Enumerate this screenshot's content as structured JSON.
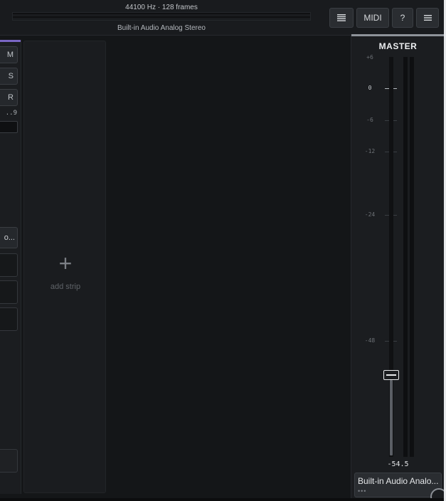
{
  "topbar": {
    "status": "44100 Hz · 128 frames",
    "device": "Built-in Audio Analog Stereo",
    "buttons": {
      "list_icon": "list-icon",
      "midi_label": "MIDI",
      "help_label": "?",
      "menu_icon": "hamburger-menu-icon"
    }
  },
  "left_strip": {
    "accent_color": "#7a67c4",
    "mute_label": "M",
    "solo_label": "S",
    "record_label": "R",
    "volume_value": "..9",
    "output_name": "o..."
  },
  "add_strip": {
    "plus_icon": "+",
    "label": "add strip"
  },
  "master": {
    "title": "MASTER",
    "scale": [
      "+6",
      "0",
      "-6",
      "-12",
      "-24",
      "-48"
    ],
    "fader_value": "-54.5",
    "output_name": "Built-in Audio Analo...",
    "output_dots": "•••"
  }
}
